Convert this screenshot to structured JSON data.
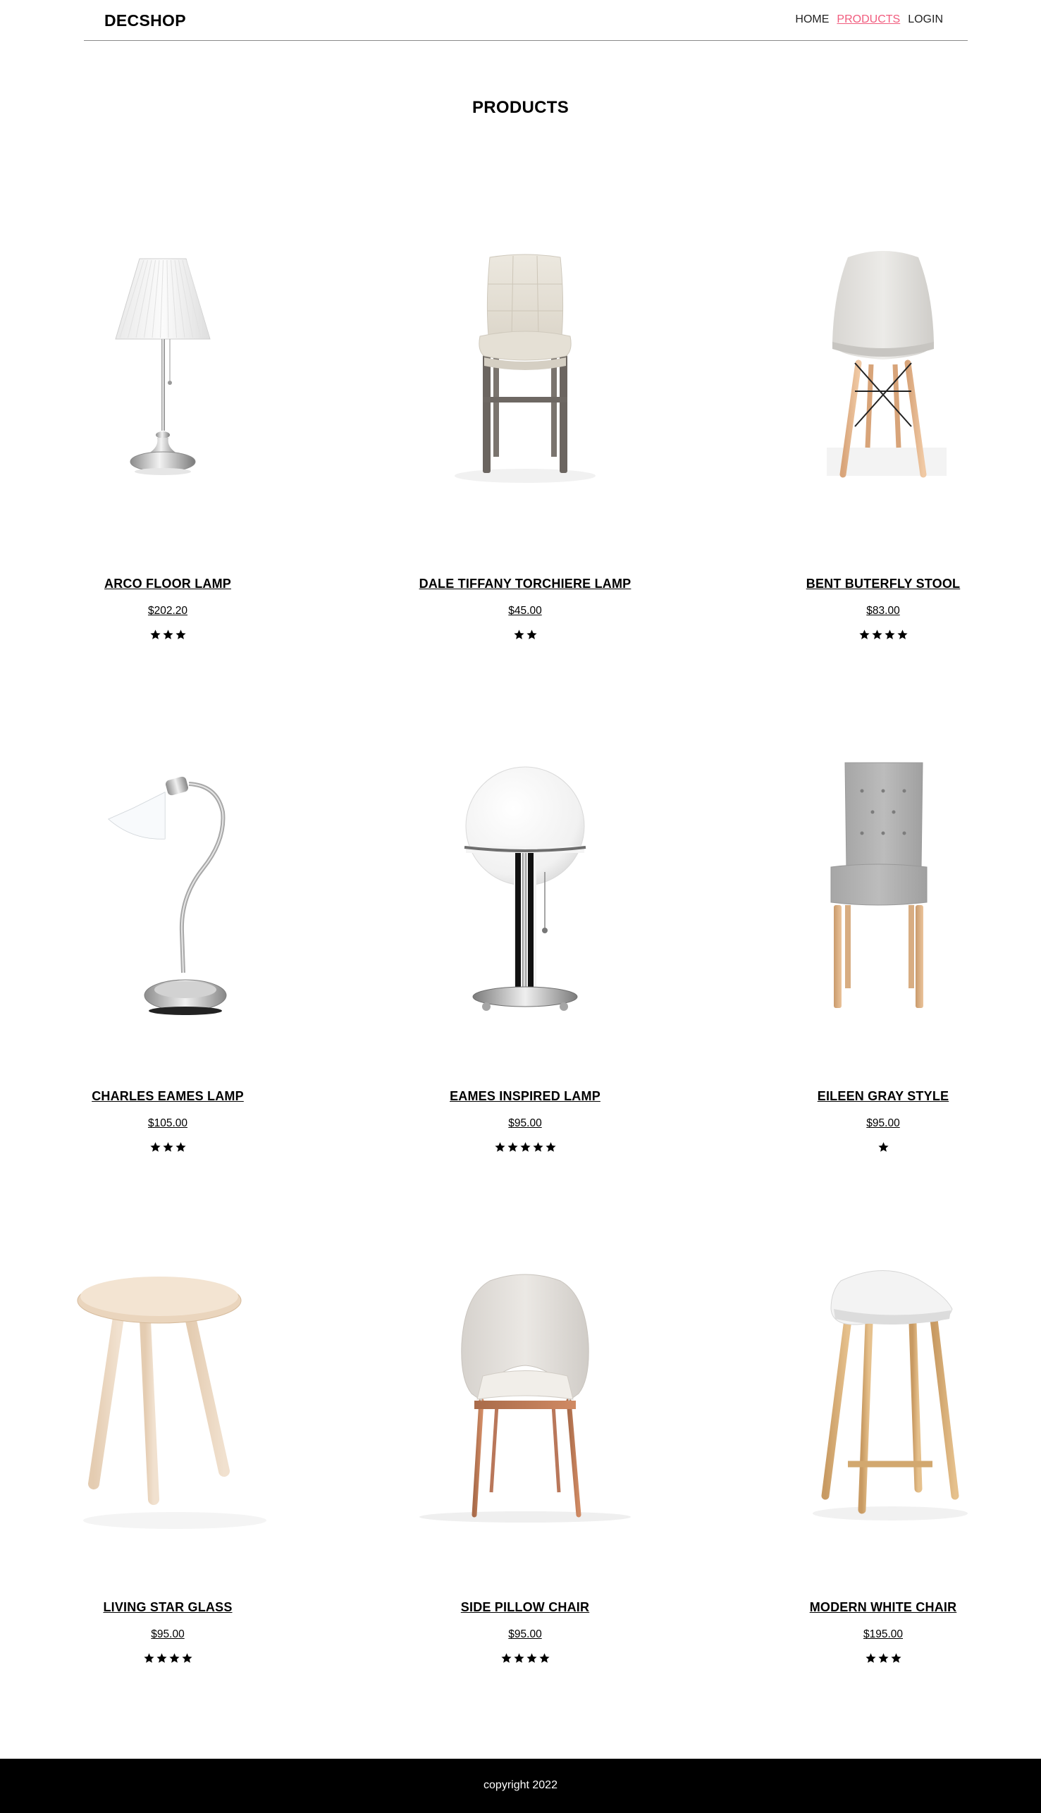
{
  "header": {
    "brand": "DECSHOP",
    "nav": [
      {
        "label": "HOME",
        "active": false
      },
      {
        "label": "PRODUCTS",
        "active": true
      },
      {
        "label": "LOGIN",
        "active": false
      }
    ]
  },
  "page_title": "PRODUCTS",
  "colors": {
    "accent": "#f15c7e",
    "footer_bg": "#000000",
    "text": "#000000"
  },
  "products": [
    {
      "name": "ARCO FLOOR LAMP",
      "price": "$202.20",
      "rating": 3,
      "image": "floor-lamp-image"
    },
    {
      "name": "DALE TIFFANY TORCHIERE LAMP",
      "price": "$45.00",
      "rating": 2,
      "image": "upholstered-chair-image"
    },
    {
      "name": "BENT BUTERFLY STOOL",
      "price": "$83.00",
      "rating": 4,
      "image": "shell-chair-image"
    },
    {
      "name": "CHARLES EAMES LAMP",
      "price": "$105.00",
      "rating": 3,
      "image": "desk-lamp-image"
    },
    {
      "name": "EAMES INSPIRED LAMP",
      "price": "$95.00",
      "rating": 5,
      "image": "globe-lamp-image"
    },
    {
      "name": "EILEEN GRAY STYLE",
      "price": "$95.00",
      "rating": 1,
      "image": "tufted-chair-image"
    },
    {
      "name": "LIVING STAR GLASS",
      "price": "$95.00",
      "rating": 4,
      "image": "round-stool-image"
    },
    {
      "name": "SIDE PILLOW CHAIR",
      "price": "$95.00",
      "rating": 4,
      "image": "armchair-image"
    },
    {
      "name": "MODERN WHITE CHAIR",
      "price": "$195.00",
      "rating": 3,
      "image": "bar-stool-image"
    }
  ],
  "footer": {
    "copyright": "copyright 2022"
  }
}
